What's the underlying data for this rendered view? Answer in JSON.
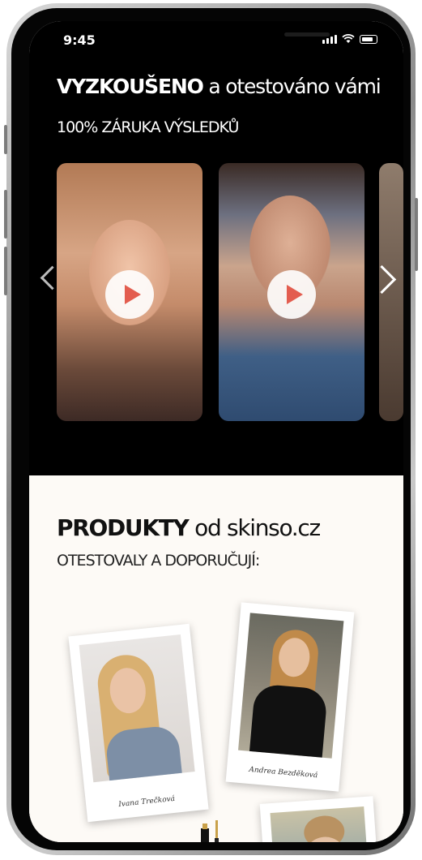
{
  "status_bar": {
    "time": "9:45"
  },
  "hero": {
    "title_bold": "VYZKOUŠENO",
    "title_rest": " a otestováno vámi",
    "subtitle": "100% ZÁRUKA VÝSLEDKŮ"
  },
  "products": {
    "title_bold": "PRODUKTY",
    "title_rest": " od skinso.cz",
    "subtitle": "OTESTOVALY A DOPORUČUJÍ:",
    "testimonials": [
      {
        "name": "Ivana Trečková"
      },
      {
        "name": "Andrea Bezděková"
      }
    ]
  },
  "colors": {
    "play_accent": "#e35d4f",
    "hero_bg": "#000000",
    "products_bg": "#fdfaf6"
  }
}
